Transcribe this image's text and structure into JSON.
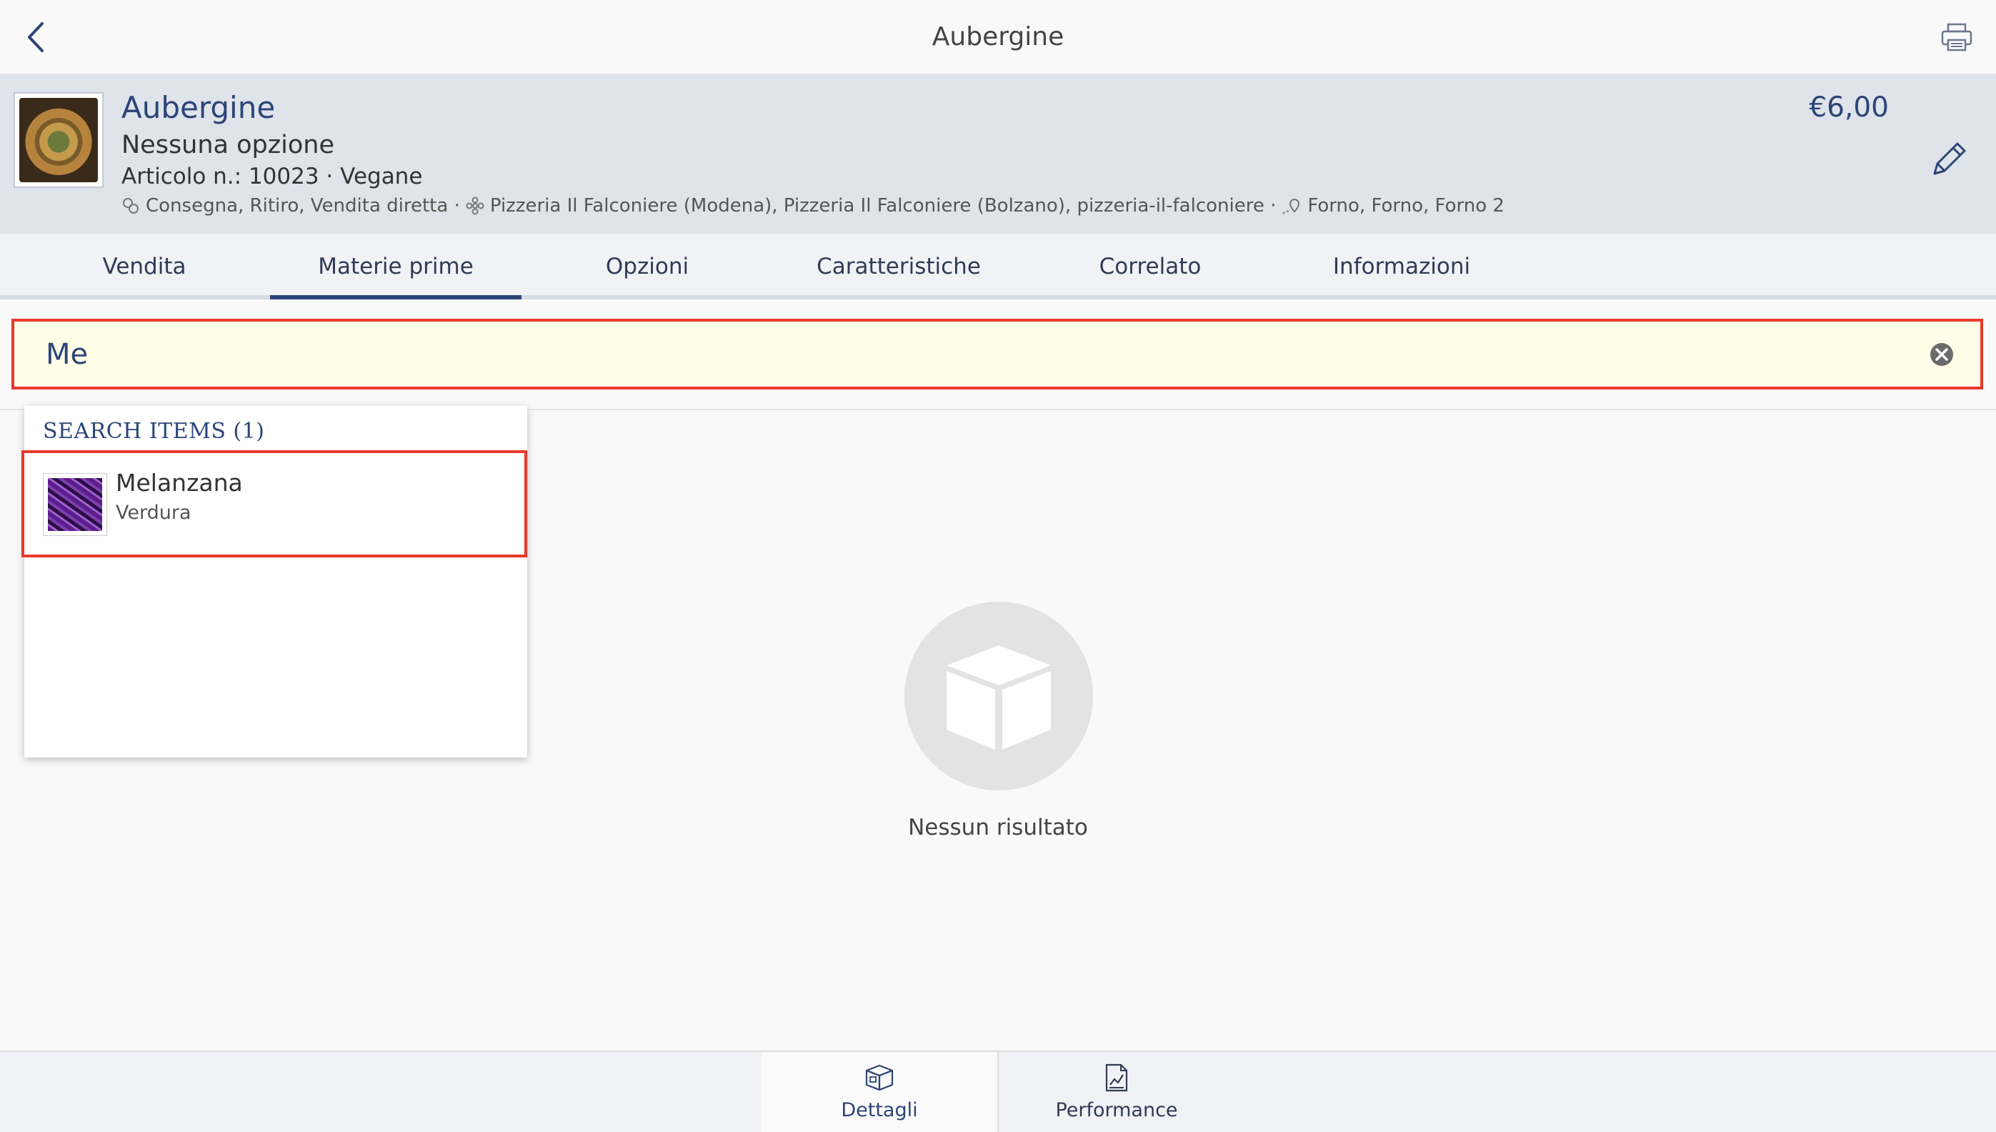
{
  "header": {
    "title": "Aubergine"
  },
  "product": {
    "name": "Aubergine",
    "option": "Nessuna opzione",
    "article": "Articolo n.: 10023 · Vegane",
    "channels": "Consegna, Ritiro, Vendita diretta ·",
    "locations": "Pizzeria Il Falconiere (Modena), Pizzeria Il Falconiere (Bolzano), pizzeria-il-falconiere ·",
    "stations": "Forno, Forno, Forno 2",
    "price": "€6,00"
  },
  "tabs": [
    {
      "label": "Vendita",
      "active": false
    },
    {
      "label": "Materie prime",
      "active": true
    },
    {
      "label": "Opzioni",
      "active": false
    },
    {
      "label": "Caratteristiche",
      "active": false
    },
    {
      "label": "Correlato",
      "active": false
    },
    {
      "label": "Informazioni",
      "active": false
    }
  ],
  "search": {
    "value": "Me"
  },
  "dropdown": {
    "header": "SEARCH ITEMS (1)",
    "items": [
      {
        "name": "Melanzana",
        "category": "Verdura"
      }
    ]
  },
  "empty": {
    "text": "Nessun risultato"
  },
  "bottom_nav": [
    {
      "label": "Dettagli",
      "icon": "box-icon",
      "active": true
    },
    {
      "label": "Performance",
      "icon": "chart-document-icon",
      "active": false
    }
  ],
  "colors": {
    "accent": "#2c4577",
    "highlight": "#e63a2a",
    "search_bg": "#fffde8"
  }
}
